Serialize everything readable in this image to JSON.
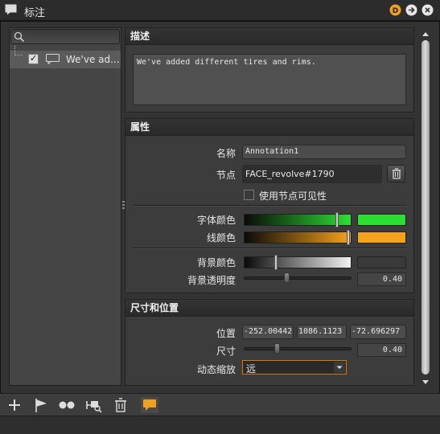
{
  "window": {
    "title": "标注"
  },
  "search": {
    "placeholder": ""
  },
  "tree": {
    "items": [
      {
        "checked": true,
        "label": "We've ad..."
      }
    ]
  },
  "description": {
    "header": "描述",
    "text": "We've added different tires and rims."
  },
  "properties": {
    "header": "属性",
    "name_label": "名称",
    "name_value": "Annotation1",
    "node_label": "节点",
    "node_value": "FACE_revolve#1790",
    "use_node_visibility_label": "使用节点可见性",
    "use_node_visibility_checked": false,
    "font_color_label": "字体颜色",
    "font_color": "#2ce033",
    "line_color_label": "线颜色",
    "line_color": "#f5a21c",
    "bg_color_label": "背景颜色",
    "bg_color": "#3a3a3a",
    "bg_opacity_label": "背景透明度",
    "bg_opacity_value": "0.40"
  },
  "size_position": {
    "header": "尺寸和位置",
    "position_label": "位置",
    "position_x": "-252.00442",
    "position_y": "1086.1123",
    "position_z": "-72.696297",
    "size_label": "尺寸",
    "size_value": "0.40",
    "dynamic_scale_label": "动态缩放",
    "dynamic_scale_value": "远"
  },
  "toolbar": {
    "icons": [
      "plus-icon",
      "flag-icon",
      "dots-icon",
      "camera-search-icon",
      "trash-icon",
      "comment-icon"
    ]
  }
}
